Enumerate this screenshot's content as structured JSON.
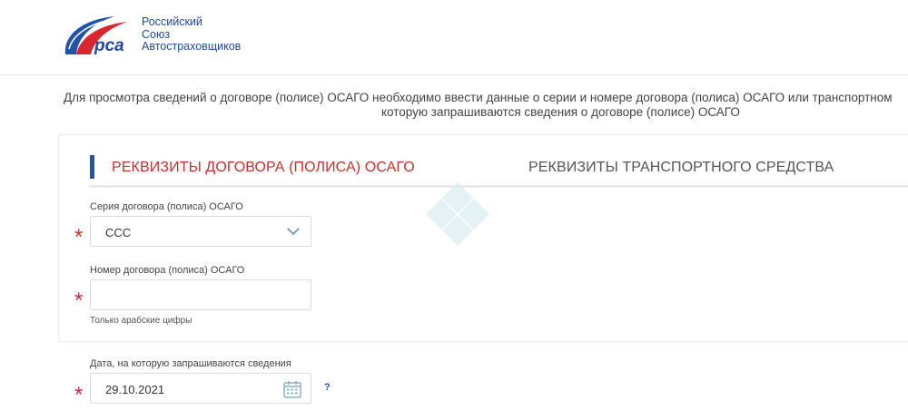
{
  "logo": {
    "mark_text": "рса",
    "line1": "Российский",
    "line2": "Союз",
    "line3": "Автостраховщиков"
  },
  "intro": {
    "line1": "Для просмотра сведений о договоре (полисе) ОСАГО необходимо ввести данные о серии и номере договора (полиса) ОСАГО или транспортном",
    "line2": "которую запрашиваются сведения о договоре (полисе) ОСАГО"
  },
  "tabs": [
    {
      "label": "РЕКВИЗИТЫ ДОГОВОРА (ПОЛИСА) ОСАГО",
      "active": true
    },
    {
      "label": "РЕКВИЗИТЫ ТРАНСПОРТНОГО СРЕДСТВА",
      "active": false
    }
  ],
  "form": {
    "series": {
      "label": "Серия договора (полиса) ОСАГО",
      "value": "ССС"
    },
    "number": {
      "label": "Номер договора (полиса) ОСАГО",
      "value": "",
      "hint": "Только арабские цифры"
    },
    "date": {
      "label": "Дата, на которую запрашиваются сведения",
      "value": "29.10.2021"
    },
    "required_mark": "*",
    "help_mark": "?"
  },
  "icons": {
    "select_arrow": "chevron-down-icon",
    "calendar": "calendar-icon",
    "watermark": "diamond-watermark-icon"
  },
  "colors": {
    "brand_blue": "#2253a8",
    "accent_red": "#c9302c",
    "border": "#dcdcdc"
  }
}
